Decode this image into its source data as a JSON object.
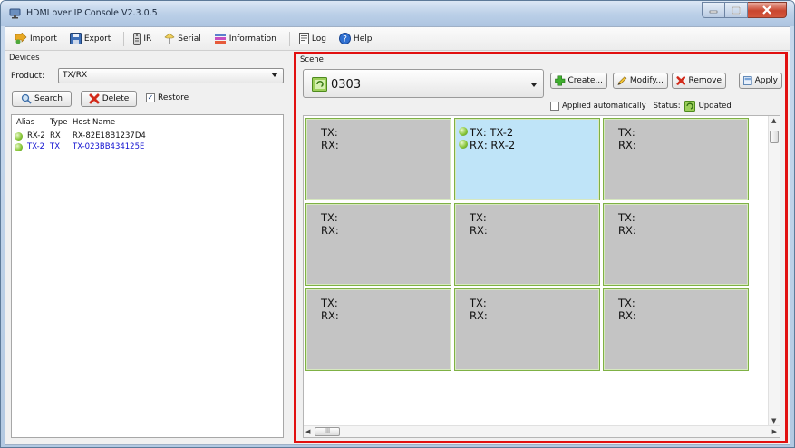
{
  "window": {
    "title": "HDMI over IP Console V2.3.0.5"
  },
  "toolbar": {
    "import_label": "Import",
    "export_label": "Export",
    "ir_label": "IR",
    "serial_label": "Serial",
    "information_label": "Information",
    "log_label": "Log",
    "help_label": "Help"
  },
  "devices": {
    "group_label": "Devices",
    "product_label": "Product:",
    "product_value": "TX/RX",
    "search_label": "Search",
    "delete_label": "Delete",
    "restore_label": "Restore",
    "restore_checked": true,
    "columns": [
      "Alias",
      "Type",
      "Host Name"
    ],
    "rows": [
      {
        "alias": "RX-2",
        "type": "RX",
        "host": "RX-82E18B1237D4",
        "selected": false
      },
      {
        "alias": "TX-2",
        "type": "TX",
        "host": "TX-023BB434125E",
        "selected": true
      }
    ]
  },
  "scene": {
    "group_label": "Scene",
    "current_scene": "0303",
    "create_label": "Create...",
    "modify_label": "Modify...",
    "remove_label": "Remove",
    "apply_label": "Apply",
    "applied_auto_label": "Applied automatically",
    "status_label": "Status:",
    "status_value": "Updated",
    "hscroll_thumb": "III",
    "cells": [
      {
        "tx": "TX:",
        "rx": "RX:",
        "active": false
      },
      {
        "tx": "TX: TX-2",
        "rx": "RX: RX-2",
        "active": true
      },
      {
        "tx": "TX:",
        "rx": "RX:",
        "active": false
      },
      {
        "tx": "TX:",
        "rx": "RX:",
        "active": false
      },
      {
        "tx": "TX:",
        "rx": "RX:",
        "active": false
      },
      {
        "tx": "TX:",
        "rx": "RX:",
        "active": false
      },
      {
        "tx": "TX:",
        "rx": "RX:",
        "active": false
      },
      {
        "tx": "TX:",
        "rx": "RX:",
        "active": false
      },
      {
        "tx": "TX:",
        "rx": "RX:",
        "active": false
      }
    ]
  },
  "colors": {
    "highlight_border": "#e11010",
    "selected_text": "#1010d0",
    "active_cell": "#bfe4f8",
    "cell_gray": "#c4c4c4",
    "cell_border": "#7fb145"
  }
}
